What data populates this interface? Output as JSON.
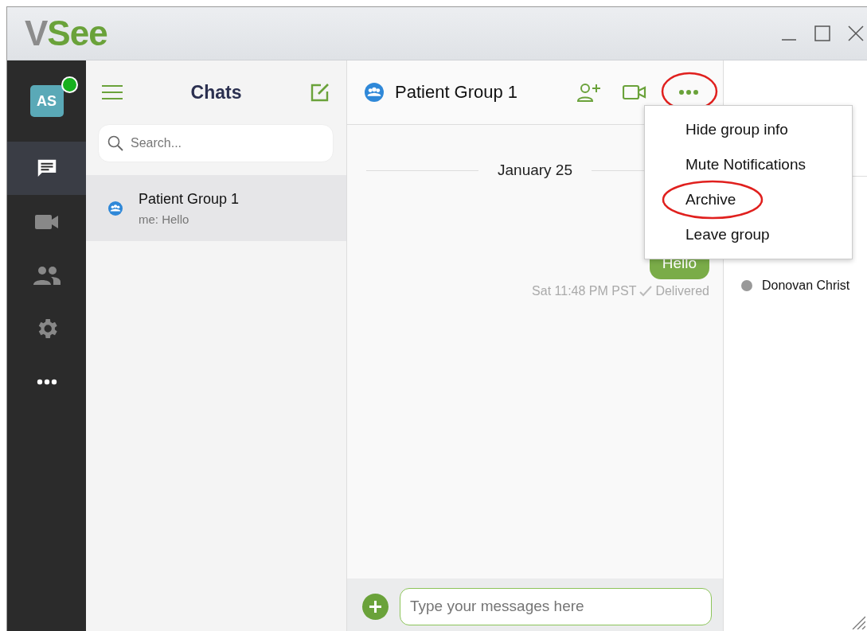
{
  "window": {
    "logo": [
      "V",
      "See"
    ]
  },
  "rail": {
    "avatar": {
      "initials": "AS",
      "online": true
    },
    "items": [
      {
        "kind": "chat",
        "selected": true
      },
      {
        "kind": "video",
        "selected": false
      },
      {
        "kind": "contacts",
        "selected": false
      },
      {
        "kind": "settings",
        "selected": false
      },
      {
        "kind": "more",
        "selected": false
      }
    ]
  },
  "chats": {
    "title": "Chats",
    "search": {
      "placeholder": "Search..."
    },
    "items": [
      {
        "name": "Patient Group 1",
        "preview": "me: Hello",
        "selected": true
      }
    ]
  },
  "conversation": {
    "title": "Patient Group 1",
    "more_circled": true,
    "date": "January 25",
    "messages": [
      {
        "text": "Hello",
        "time": "Sat 11:48 PM PST",
        "status": "Delivered"
      }
    ],
    "composer": {
      "placeholder": "Type your messages here"
    }
  },
  "menu": {
    "items": [
      {
        "label": "Hide group info",
        "circled": false
      },
      {
        "label": "Mute Notifications",
        "circled": false
      },
      {
        "label": "Archive",
        "circled": true
      },
      {
        "label": "Leave group",
        "circled": false
      }
    ]
  },
  "members": [
    {
      "name": "Donovan Christ",
      "online": false
    }
  ]
}
